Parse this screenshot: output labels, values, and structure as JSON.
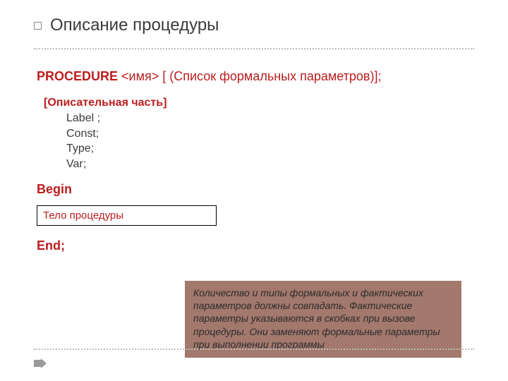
{
  "title": "Описание процедуры",
  "procedure_keyword": "PROCEDURE",
  "procedure_rest": "  <имя> [ (Список формальных параметров)];",
  "descriptive_header": "[Описательная часть]",
  "declarations": [
    "Label ;",
    "Const;",
    "Type;",
    "Var;"
  ],
  "begin_kw": "Begin",
  "body_label": "Тело процедуры",
  "end_kw": "End;",
  "note": "Количество и типы формальных и фактических параметров должны совпадать. Фактические параметры указываются в скобках при вызове процедуры. Они заменяют формальные параметры при выполнении программы"
}
